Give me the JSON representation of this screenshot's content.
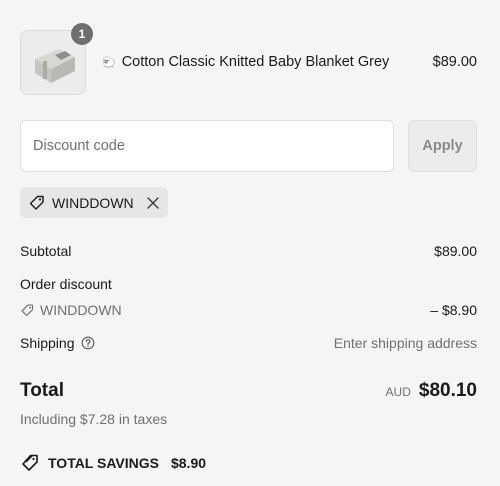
{
  "cart": {
    "item": {
      "quantity": "1",
      "emoji": "🐑",
      "title": "Cotton Classic Knitted Baby Blanket Grey",
      "price": "$89.00"
    }
  },
  "discount": {
    "placeholder": "Discount code",
    "apply_label": "Apply",
    "applied_code": "WINDDOWN"
  },
  "summary": {
    "subtotal_label": "Subtotal",
    "subtotal_value": "$89.00",
    "order_discount_label": "Order discount",
    "discount_code": "WINDDOWN",
    "discount_value": "– $8.90",
    "shipping_label": "Shipping",
    "shipping_value": "Enter shipping address",
    "total_label": "Total",
    "currency": "AUD",
    "total_value": "$80.10",
    "tax_note": "Including $7.28 in taxes",
    "savings_label": "TOTAL SAVINGS",
    "savings_value": "$8.90"
  },
  "icons": {
    "tag": "tag-icon",
    "close": "close-icon",
    "help": "help-circle-icon",
    "savings": "savings-tag-icon"
  }
}
